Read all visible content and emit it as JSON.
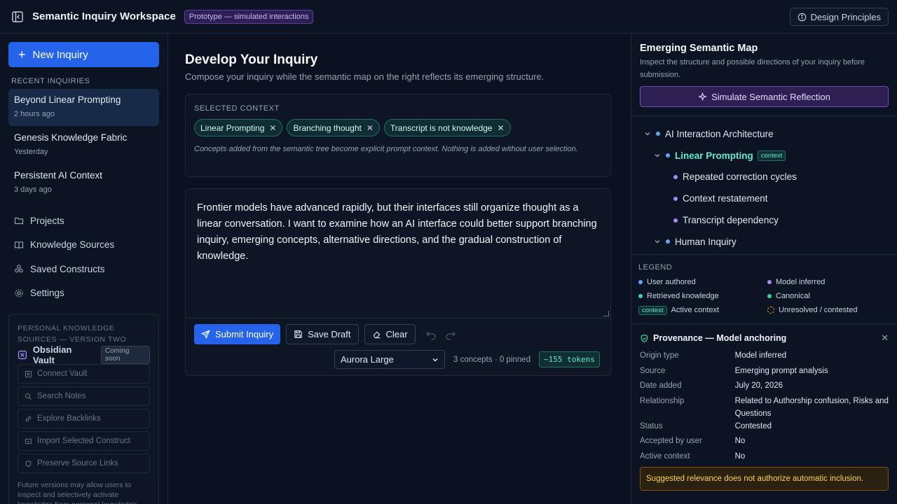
{
  "header": {
    "title": "Semantic Inquiry Workspace",
    "badge": "Prototype — simulated interactions",
    "design_principles": "Design Principles"
  },
  "sidebar": {
    "new_inquiry": "New Inquiry",
    "recent_heading": "RECENT INQUIRIES",
    "recent": [
      {
        "title": "Beyond Linear Prompting",
        "time": "2 hours ago"
      },
      {
        "title": "Genesis Knowledge Fabric",
        "time": "Yesterday"
      },
      {
        "title": "Persistent AI Context",
        "time": "3 days ago"
      }
    ],
    "nav": [
      {
        "label": "Projects",
        "icon": "folder-icon"
      },
      {
        "label": "Knowledge Sources",
        "icon": "book-icon"
      },
      {
        "label": "Saved Constructs",
        "icon": "constructs-icon"
      },
      {
        "label": "Settings",
        "icon": "gear-icon"
      }
    ],
    "pks": {
      "heading": "PERSONAL KNOWLEDGE SOURCES — VERSION TWO",
      "vault_name": "Obsidian Vault",
      "vault_badge": "Coming soon",
      "buttons": [
        "Connect Vault",
        "Search Notes",
        "Explore Backlinks",
        "Import Selected Construct",
        "Preserve Source Links"
      ],
      "note": "Future versions may allow users to inspect and selectively activate knowledge from personal knowledge"
    }
  },
  "main": {
    "title": "Develop Your Inquiry",
    "subtitle": "Compose your inquiry while the semantic map on the right reflects its emerging structure.",
    "context_label": "SELECTED CONTEXT",
    "chips": [
      "Linear Prompting",
      "Branching thought",
      "Transcript is not knowledge"
    ],
    "context_note": "Concepts added from the semantic tree become explicit prompt context. Nothing is added without user selection.",
    "editor_text": "Frontier models have advanced rapidly, but their interfaces still organize thought as a linear conversation. I want to examine how an AI interface could better support branching inquiry, emerging concepts, alternative directions, and the gradual construction of knowledge.",
    "submit": "Submit Inquiry",
    "save_draft": "Save Draft",
    "clear": "Clear",
    "model": "Aurora Large",
    "meta": "3 concepts · 0 pinned",
    "tokens": "~155 tokens"
  },
  "right": {
    "title": "Emerging Semantic Map",
    "subtitle": "Inspect the structure and possible directions of your inquiry before submission.",
    "simulate": "Simulate Semantic Reflection",
    "tree": [
      {
        "label": "AI Interaction Architecture",
        "level": 0,
        "caret": true,
        "dot": "#60a5fa"
      },
      {
        "label": "Linear Prompting",
        "level": 1,
        "caret": true,
        "dot": "#60a5fa",
        "tag": "context",
        "highlight": true
      },
      {
        "label": "Repeated correction cycles",
        "level": 2,
        "caret": false,
        "dot": "#a78bfa"
      },
      {
        "label": "Context restatement",
        "level": 2,
        "caret": false,
        "dot": "#a78bfa"
      },
      {
        "label": "Transcript dependency",
        "level": 2,
        "caret": false,
        "dot": "#a78bfa"
      },
      {
        "label": "Human Inquiry",
        "level": 1,
        "caret": true,
        "dot": "#60a5fa"
      }
    ],
    "legend_title": "LEGEND",
    "legend": [
      {
        "label": "User authored",
        "kind": "dot",
        "color": "#60a5fa"
      },
      {
        "label": "Model inferred",
        "kind": "dot",
        "color": "#a78bfa"
      },
      {
        "label": "Retrieved knowledge",
        "kind": "dot",
        "color": "#2dd4bf"
      },
      {
        "label": "Canonical",
        "kind": "dot",
        "color": "#34d399"
      },
      {
        "label": "Active context",
        "kind": "box",
        "box_label": "context"
      },
      {
        "label": "Unresolved / contested",
        "kind": "dashed",
        "color": "#eab308"
      }
    ],
    "provenance": {
      "title": "Provenance — Model anchoring",
      "rows": [
        {
          "k": "Origin type",
          "v": "Model inferred"
        },
        {
          "k": "Source",
          "v": "Emerging prompt analysis"
        },
        {
          "k": "Date added",
          "v": "July 20, 2026"
        },
        {
          "k": "Relationship",
          "v": "Related to Authorship confusion, Risks and Questions"
        },
        {
          "k": "Status",
          "v": "Contested"
        },
        {
          "k": "Accepted by user",
          "v": "No"
        },
        {
          "k": "Active context",
          "v": "No"
        }
      ],
      "warning": "Suggested relevance does not authorize automatic inclusion."
    }
  }
}
